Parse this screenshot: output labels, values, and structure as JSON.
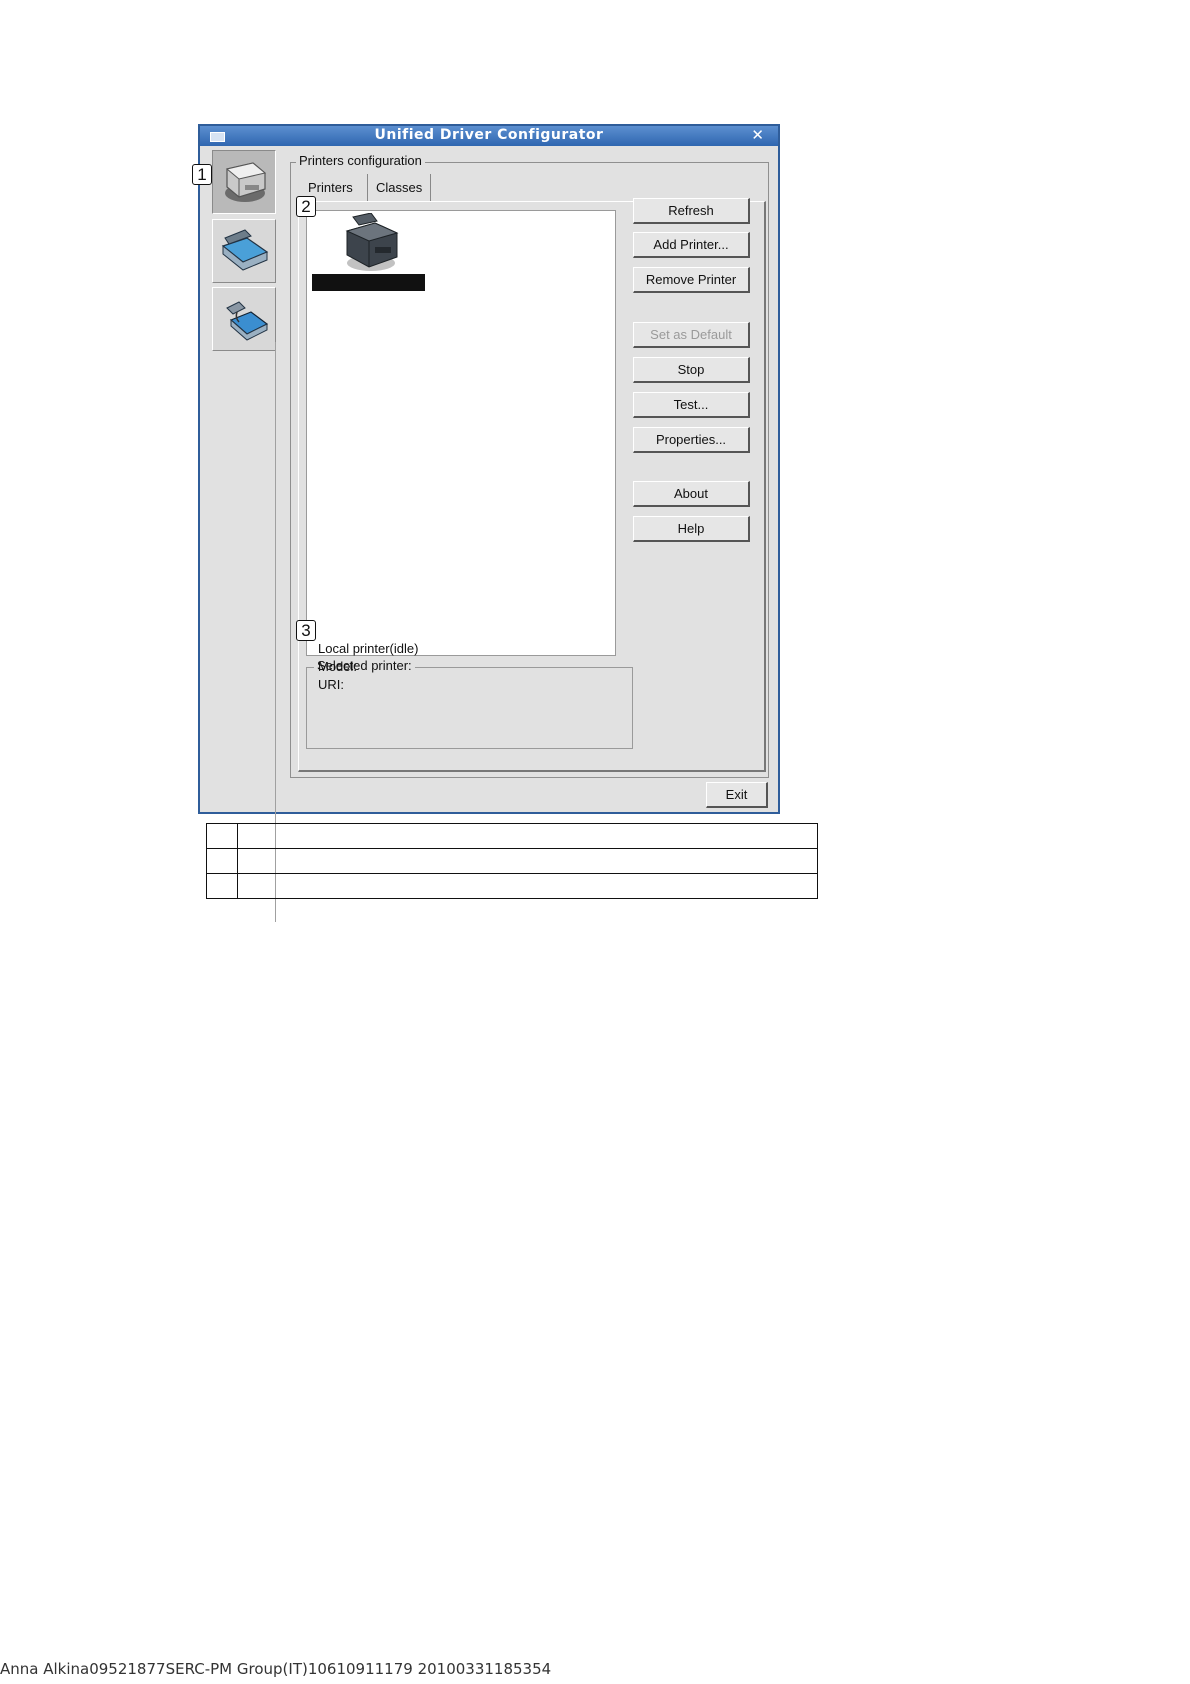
{
  "window": {
    "title": "Unified Driver Configurator",
    "close_glyph": "✕"
  },
  "sidebar": {
    "items": [
      {
        "name": "printers",
        "icon": "printer-icon",
        "active": true
      },
      {
        "name": "scanners",
        "icon": "scanner-icon",
        "active": false
      },
      {
        "name": "ports",
        "icon": "port-icon",
        "active": false
      }
    ]
  },
  "callouts": [
    "1",
    "2",
    "3"
  ],
  "printers_config": {
    "title": "Printers configuration",
    "tabs": [
      {
        "label": "Printers",
        "active": true
      },
      {
        "label": "Classes",
        "active": false
      }
    ],
    "printer_icon": "printer-device-icon"
  },
  "buttons": {
    "refresh": "Refresh",
    "add_printer": "Add Printer...",
    "remove_printer": "Remove Printer",
    "set_default": "Set as Default",
    "stop": "Stop",
    "test": "Test...",
    "properties": "Properties...",
    "about": "About",
    "help": "Help",
    "exit": "Exit"
  },
  "selected_printer": {
    "title": "Selected printer:",
    "status": "Local printer(idle)",
    "model_label": "Model:",
    "uri_label": "URI:"
  },
  "legend_table": [
    {
      "num": "",
      "text": ""
    },
    {
      "num": "",
      "text": ""
    },
    {
      "num": "",
      "text": ""
    }
  ],
  "footer": {
    "text": "Anna Alkina09521877SERC-PM Group(IT)10610911179 20100331185354"
  }
}
